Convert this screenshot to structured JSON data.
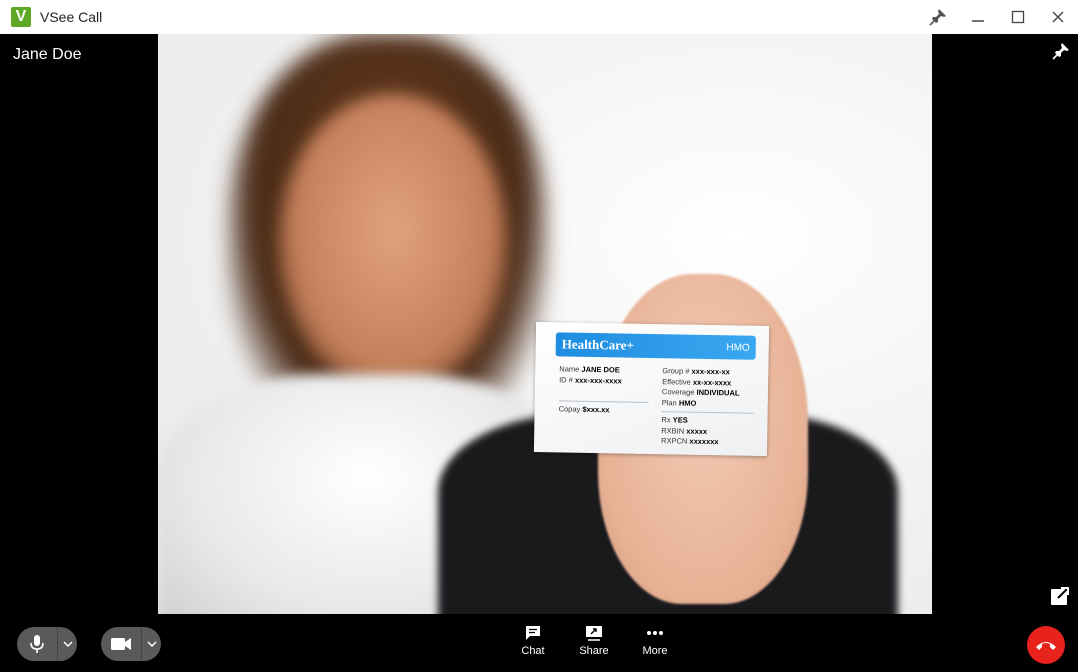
{
  "window": {
    "logo_letter": "V",
    "title": "VSee Call"
  },
  "video": {
    "caller_name": "Jane Doe"
  },
  "card": {
    "brand": "HealthCare+",
    "plan_tag": "HMO",
    "name_label": "Name",
    "name_value": "JANE DOE",
    "id_label": "ID #",
    "id_value": "xxx-xxx-xxxx",
    "copay_label": "Copay",
    "copay_value": "$xxx.xx",
    "group_label": "Group #",
    "group_value": "xxx-xxx-xx",
    "effective_label": "Effective",
    "effective_value": "xx-xx-xxxx",
    "coverage_label": "Coverage",
    "coverage_value": "INDIVIDUAL",
    "plan_label": "Plan",
    "plan_value": "HMO",
    "rx_label": "Rx",
    "rx_value": "YES",
    "rxbin_label": "RXBIN",
    "rxbin_value": "xxxxx",
    "rxpcn_label": "RXPCN",
    "rxpcn_value": "xxxxxxx"
  },
  "toolbar": {
    "chat_label": "Chat",
    "share_label": "Share",
    "more_label": "More"
  },
  "colors": {
    "brand_green": "#5fa826",
    "hangup_red": "#e8231e",
    "card_blue": "#1f8de0"
  },
  "icons": [
    "pin-icon",
    "minimize-icon",
    "maximize-icon",
    "close-icon",
    "microphone-icon",
    "camera-icon",
    "chevron-down-icon",
    "chat-icon",
    "share-screen-icon",
    "more-icon",
    "hang-up-icon",
    "popout-icon"
  ]
}
